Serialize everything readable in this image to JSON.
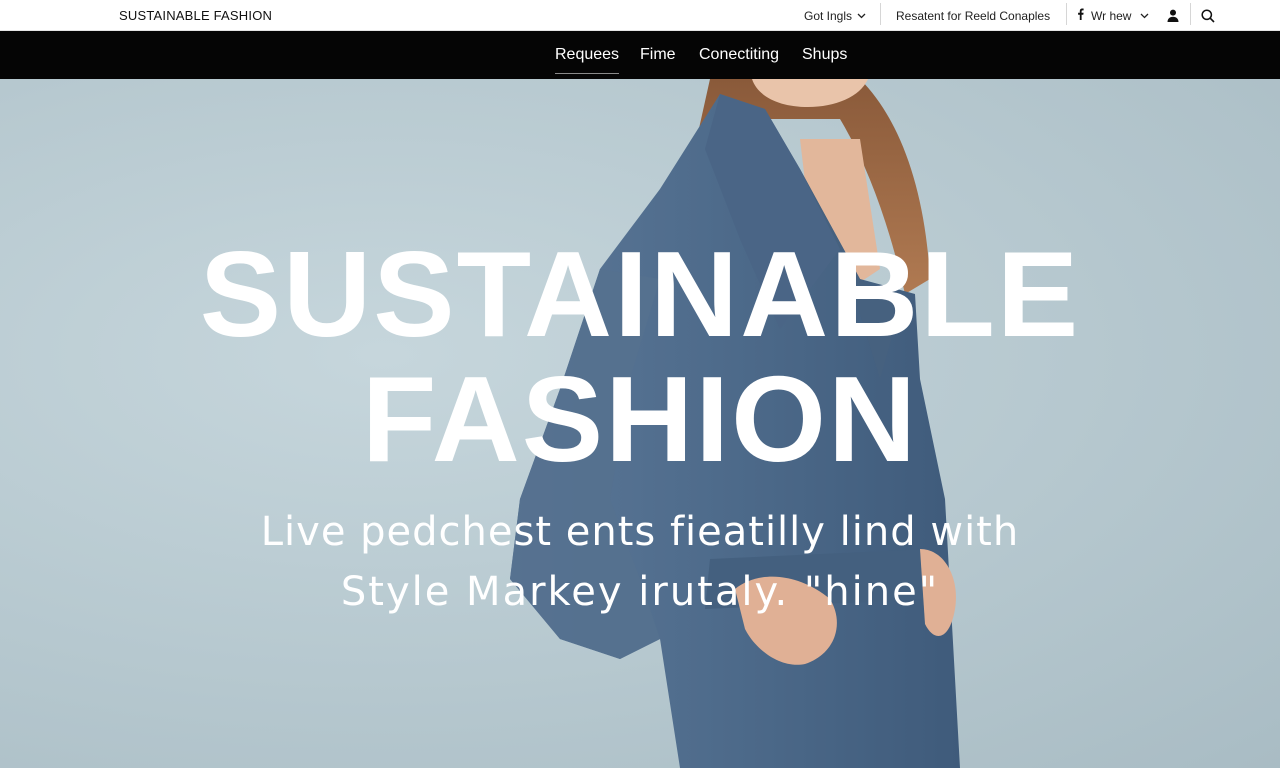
{
  "header": {
    "brand": "SUSTAINABLE FASHION",
    "language_label": "Got Ingls",
    "resource_link": "Resatent for Reeld Conaples",
    "social_label": "Wr hew"
  },
  "nav": {
    "items": [
      {
        "label": "Requees",
        "active": true
      },
      {
        "label": "Fime"
      },
      {
        "label": "Conectiting"
      },
      {
        "label": "Shups"
      }
    ]
  },
  "hero": {
    "headline_line1": "SUSTAINABLE",
    "headline_line2": "FASHION",
    "tagline_line1": "Live pedchest ents fieatilly lind with",
    "tagline_line2": "Style Markey irutaly. \"hine\""
  },
  "icons": {
    "language_dropdown": "chevron-down-icon",
    "social": "facebook-icon",
    "social_dropdown": "chevron-down-icon",
    "account": "user-icon",
    "search": "search-icon"
  },
  "colors": {
    "nav_background": "#050505",
    "hero_background": "#b9cbd2",
    "coat": "#4f6c8c",
    "text_on_hero": "#ffffff"
  }
}
